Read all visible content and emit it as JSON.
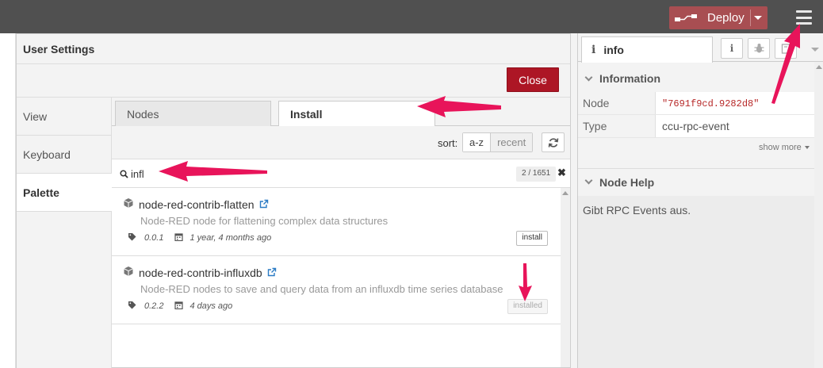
{
  "header": {
    "deploy_label": "Deploy",
    "menu_icon": "hamburger-menu-icon",
    "deploy_icon": "deploy-flow-icon",
    "brand_color": "#a84e52"
  },
  "dialog": {
    "title": "User Settings",
    "close_label": "Close",
    "close_color": "#ad1625",
    "nav": [
      {
        "label": "View"
      },
      {
        "label": "Keyboard"
      },
      {
        "label": "Palette"
      }
    ],
    "active_nav": "Palette",
    "tabs": [
      {
        "label": "Nodes"
      },
      {
        "label": "Install"
      }
    ],
    "active_tab": "Install",
    "sort": {
      "label": "sort:",
      "options": [
        "a-z",
        "recent"
      ],
      "selected": "a-z"
    },
    "search": {
      "value": "infl",
      "count": "2 / 1651",
      "clear": "✖"
    },
    "results": [
      {
        "name": "node-red-contrib-flatten",
        "description": "Node-RED node for flattening complex data structures",
        "version": "0.0.1",
        "updated": "1 year, 4 months ago",
        "action": "install",
        "installed": false
      },
      {
        "name": "node-red-contrib-influxdb",
        "description": "Node-RED nodes to save and query data from an influxdb time series database",
        "version": "0.2.2",
        "updated": "4 days ago",
        "action": "installed",
        "installed": true
      }
    ]
  },
  "sidebar": {
    "active_tab": "info",
    "info_glyph": "i",
    "information": {
      "heading": "Information",
      "rows": [
        {
          "key": "Node",
          "value": "\"7691f9cd.9282d8\""
        },
        {
          "key": "Type",
          "value": "ccu-rpc-event"
        }
      ],
      "show_more": "show more"
    },
    "help": {
      "heading": "Node Help",
      "text": "Gibt RPC Events aus."
    }
  },
  "annotation_color": "#e8145a"
}
